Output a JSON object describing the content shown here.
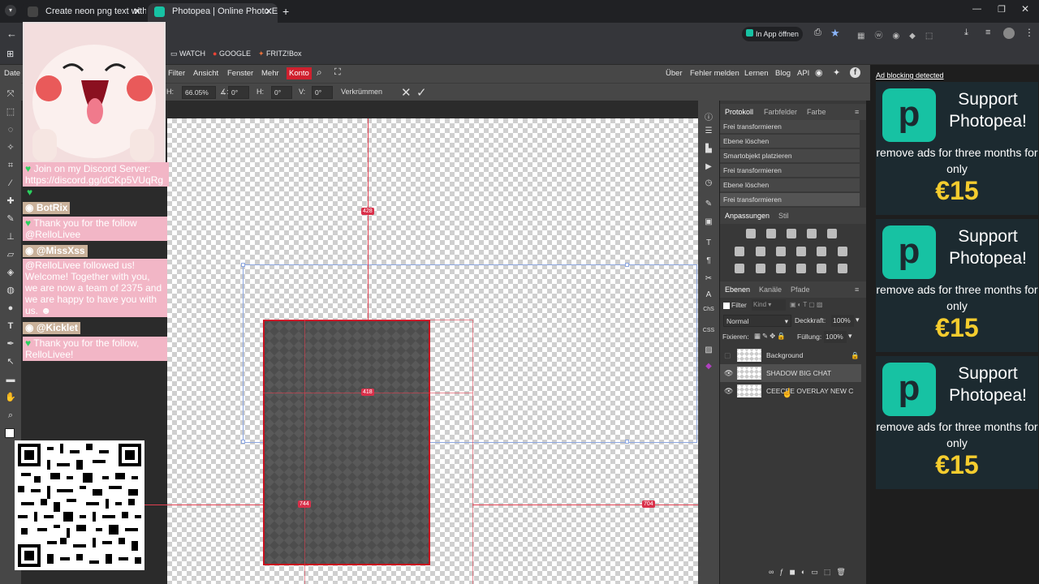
{
  "browser": {
    "tabs": [
      {
        "title": "Create neon png text with a tra",
        "active": false
      },
      {
        "title": "Photopea | Online Photo Editor",
        "active": true
      }
    ],
    "open_in_app": "In App öffnen",
    "bookmarks": [
      "WATCH",
      "GOOGLE",
      "FRITZ!Box"
    ]
  },
  "menu": {
    "left_label": "Date",
    "items": [
      "Filter",
      "Ansicht",
      "Fenster",
      "Mehr"
    ],
    "account": "Konto",
    "right_items": [
      "Über",
      "Fehler melden",
      "Lernen",
      "Blog",
      "API"
    ],
    "ad_blocking": "Ad blocking detected"
  },
  "options": {
    "h_label": "H:",
    "h_value": "66.05%",
    "angle_label": "∡:",
    "angle_value": "0°",
    "hskew_label": "H:",
    "hskew_value": "0°",
    "vskew_label": "V:",
    "vskew_value": "0°",
    "warp": "Verkrümmen"
  },
  "canvas": {
    "measurements": [
      "428",
      "418",
      "744",
      "704"
    ]
  },
  "panels": {
    "history_tabs": [
      "Protokoll",
      "Farbfelder",
      "Farbe"
    ],
    "history": [
      "Frei transformieren",
      "Ebene löschen",
      "Smartobjekt platzieren",
      "Frei transformieren",
      "Ebene löschen",
      "Frei transformieren"
    ],
    "adjust_tabs": [
      "Anpassungen",
      "Stil"
    ],
    "layers_tabs": [
      "Ebenen",
      "Kanäle",
      "Pfade"
    ],
    "filter_label": "Filter",
    "kind_label": "Kind",
    "blend_mode": "Normal",
    "opacity_label": "Deckkraft:",
    "opacity_value": "100%",
    "lock_label": "Fixieren:",
    "fill_label": "Füllung:",
    "fill_value": "100%",
    "layers": [
      {
        "name": "Background",
        "visible": false,
        "locked": true
      },
      {
        "name": "SHADOW BIG CHAT",
        "visible": true,
        "locked": false
      },
      {
        "name": "CEECEE OVERLAY NEW C",
        "visible": true,
        "locked": false
      }
    ],
    "side_labels": [
      "ChS",
      "CSS"
    ]
  },
  "ads": [
    {
      "title": "Support Photopea!",
      "body": "remove ads for three months for only",
      "price": "€15"
    },
    {
      "title": "Support Photopea!",
      "body": "remove ads for three months for only",
      "price": "€15"
    },
    {
      "title": "Support Photopea!",
      "body": "remove ads for three months for only",
      "price": "€15"
    }
  ],
  "stream_overlay": {
    "chat": [
      {
        "type": "text",
        "text": "Join on my Discord Server: https://discord.gg/dCKp5VUqRg"
      },
      {
        "type": "name",
        "text": "BotRix"
      },
      {
        "type": "text",
        "text": "Thank you for the follow @RelloLivee"
      },
      {
        "type": "name",
        "text": "@MissXss"
      },
      {
        "type": "text",
        "text": "@RelloLivee followed us! Welcome! Together with you, we are now a team of 2375 and we are happy to have you with us."
      },
      {
        "type": "name",
        "text": "@Kicklet"
      },
      {
        "type": "text",
        "text": "Thank you for the follow, RelloLivee!"
      }
    ]
  }
}
